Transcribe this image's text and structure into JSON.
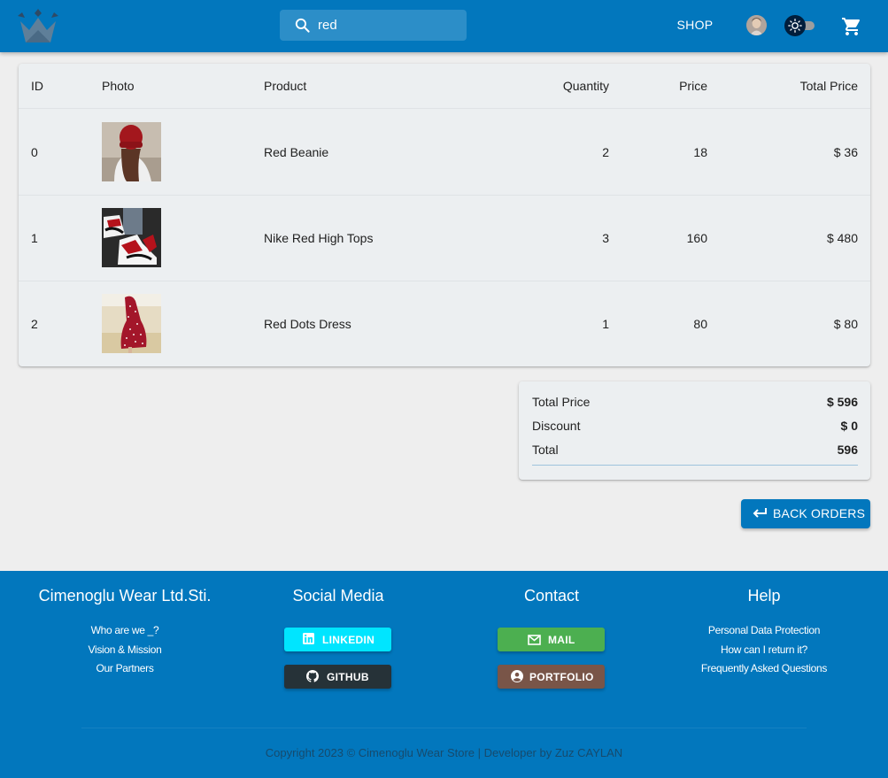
{
  "header": {
    "search_value": "red",
    "shop_label": "SHOP",
    "icons": [
      "crown-logo-icon",
      "search-icon",
      "avatar",
      "sun-icon",
      "cart-icon"
    ]
  },
  "table": {
    "headers": {
      "id": "ID",
      "photo": "Photo",
      "product": "Product",
      "quantity": "Quantity",
      "price": "Price",
      "total": "Total Price"
    },
    "rows": [
      {
        "id": "0",
        "product": "Red Beanie",
        "quantity": "2",
        "price": "18",
        "total": "$ 36"
      },
      {
        "id": "1",
        "product": "Nike Red High Tops",
        "quantity": "3",
        "price": "160",
        "total": "$ 480"
      },
      {
        "id": "2",
        "product": "Red Dots Dress",
        "quantity": "1",
        "price": "80",
        "total": "$ 80"
      }
    ]
  },
  "summary": {
    "total_price_label": "Total Price",
    "total_price_value": "$ 596",
    "discount_label": "Discount",
    "discount_value": "$ 0",
    "total_label": "Total",
    "total_value": "596"
  },
  "back_button": "BACK ORDERS",
  "footer": {
    "company": {
      "title": "Cimenoglu Wear Ltd.Sti.",
      "links": [
        "Who are we _?",
        "Vision & Mission",
        "Our Partners"
      ]
    },
    "social": {
      "title": "Social Media",
      "linkedin": "LINKEDIN",
      "github": "GITHUB"
    },
    "contact": {
      "title": "Contact",
      "mail": "MAIL",
      "portfolio": "PORTFOLIO"
    },
    "help": {
      "title": "Help",
      "links": [
        "Personal Data Protection",
        "How can I return it?",
        "Frequently Asked Questions"
      ]
    },
    "copyright": "Copyright 2023 © Cimenoglu Wear Store | Developer by Zuz CAYLAN"
  },
  "colors": {
    "primary": "#0277bd",
    "linkedin": "#00e5ff",
    "github": "#263238",
    "mail": "#4caf50",
    "portfolio": "#795548"
  }
}
